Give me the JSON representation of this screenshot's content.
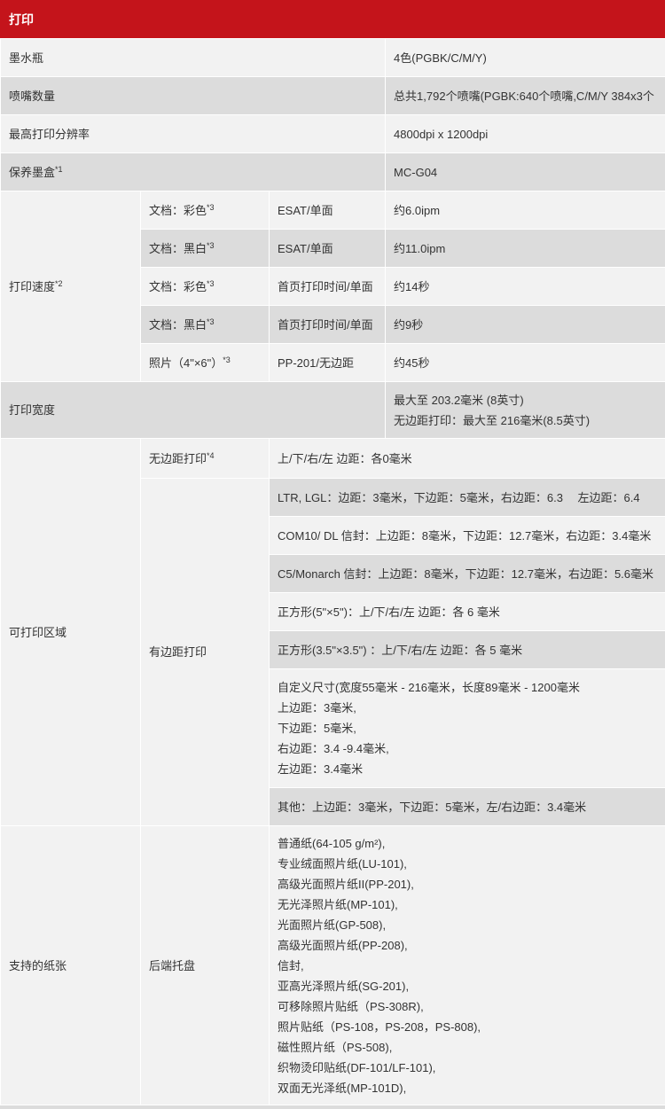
{
  "header": {
    "title": "打印"
  },
  "rows": {
    "ink_tank": {
      "label": "墨水瓶",
      "value": "4色(PGBK/C/M/Y)"
    },
    "nozzles": {
      "label": "喷嘴数量",
      "value": "总共1,792个喷嘴(PGBK:640个喷嘴,C/M/Y 384x3个"
    },
    "resolution": {
      "label": "最高打印分辨率",
      "value": "4800dpi x 1200dpi"
    },
    "cartridge": {
      "label": "保养墨盒",
      "sup": "*1",
      "value": "MC-G04"
    }
  },
  "speed": {
    "label": "打印速度",
    "sup": "*2",
    "items": [
      {
        "type": "文档：彩色",
        "sup": "*3",
        "mode": "ESAT/单面",
        "value": "约6.0ipm"
      },
      {
        "type": "文档：黑白",
        "sup": "*3",
        "mode": "ESAT/单面",
        "value": "约11.0ipm"
      },
      {
        "type": "文档：彩色",
        "sup": "*3",
        "mode": "首页打印时间/单面",
        "value": "约14秒"
      },
      {
        "type": "文档：黑白",
        "sup": "*3",
        "mode": "首页打印时间/单面",
        "value": "约9秒"
      },
      {
        "type": "照片（4\"×6\"）",
        "sup": "*3",
        "mode": "PP-201/无边距",
        "value": "约45秒"
      }
    ]
  },
  "width": {
    "label": "打印宽度",
    "lines": [
      "最大至 203.2毫米 (8英寸)",
      "无边距打印：最大至 216毫米(8.5英寸)"
    ]
  },
  "area": {
    "label": "可打印区域",
    "borderless": {
      "label": "无边距打印",
      "sup": "*4",
      "value": "上/下/右/左 边距：各0毫米"
    },
    "bordered": {
      "label": "有边距打印",
      "items": [
        "LTR, LGL：边距：3毫米，下边距：5毫米，右边距：6.3　 左边距：6.4",
        "COM10/ DL 信封：上边距：8毫米，下边距：12.7毫米，右边距：3.4毫米",
        "C5/Monarch 信封：上边距：8毫米，下边距：12.7毫米，右边距：5.6毫米",
        "正方形(5\"×5\")：上/下/右/左 边距：各 6 毫米",
        "正方形(3.5\"×3.5\") ：上/下/右/左 边距：各 5 毫米"
      ],
      "custom": [
        "自定义尺寸(宽度55毫米 - 216毫米，长度89毫米 - 1200毫米",
        "上边距：3毫米,",
        "下边距：5毫米,",
        "右边距：3.4 -9.4毫米,",
        "左边距：3.4毫米"
      ],
      "other": "其他：上边距：3毫米，下边距：5毫米，左/右边距：3.4毫米"
    }
  },
  "paper": {
    "label": "支持的纸张",
    "tray": "后端托盘",
    "items": [
      "普通纸(64-105 g/m²),",
      "专业绒面照片纸(LU-101),",
      "高级光面照片纸II(PP-201),",
      "无光泽照片纸(MP-101),",
      "光面照片纸(GP-508),",
      "高级光面照片纸(PP-208),",
      "信封,",
      "亚高光泽照片纸(SG-201),",
      "可移除照片贴纸（PS-308R),",
      "照片贴纸（PS-108，PS-208，PS-808),",
      "磁性照片纸（PS-508),",
      "织物烫印贴纸(DF-101/LF-101),",
      "双面无光泽纸(MP-101D),"
    ]
  },
  "colors": {
    "header_bg": "#c4141b",
    "row_light": "#f2f2f2",
    "row_dark": "#dcdcdc"
  }
}
